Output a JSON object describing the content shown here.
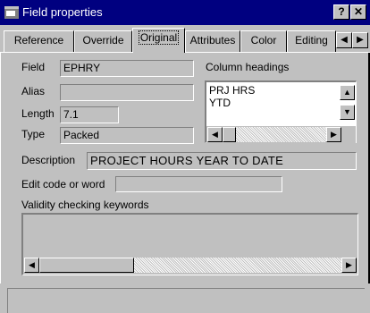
{
  "window": {
    "title": "Field properties",
    "help_label": "?",
    "close_label": "✕"
  },
  "tabs": [
    {
      "label": "Reference"
    },
    {
      "label": "Override"
    },
    {
      "label": "Original",
      "active": true
    },
    {
      "label": "Attributes"
    },
    {
      "label": "Color"
    },
    {
      "label": "Editing"
    }
  ],
  "tab_scroll": {
    "left": "◀",
    "right": "▶"
  },
  "form": {
    "field_label": "Field",
    "field_value": "EPHRY",
    "alias_label": "Alias",
    "alias_value": "",
    "length_label": "Length",
    "length_value": "7.1",
    "type_label": "Type",
    "type_value": "Packed",
    "column_headings_label": "Column headings",
    "column_headings": [
      "PRJ HRS",
      "YTD"
    ],
    "description_label": "Description",
    "description_value": "PROJECT HOURS YEAR TO DATE",
    "edit_code_label": "Edit code or word",
    "edit_code_value": "",
    "validity_label": "Validity checking keywords",
    "validity_value": ""
  },
  "scroll_glyphs": {
    "up": "▲",
    "down": "▼",
    "left": "◀",
    "right": "▶"
  },
  "colors": {
    "titlebar": "#000080",
    "face": "#c0c0c0"
  },
  "status": {
    "text": ""
  }
}
